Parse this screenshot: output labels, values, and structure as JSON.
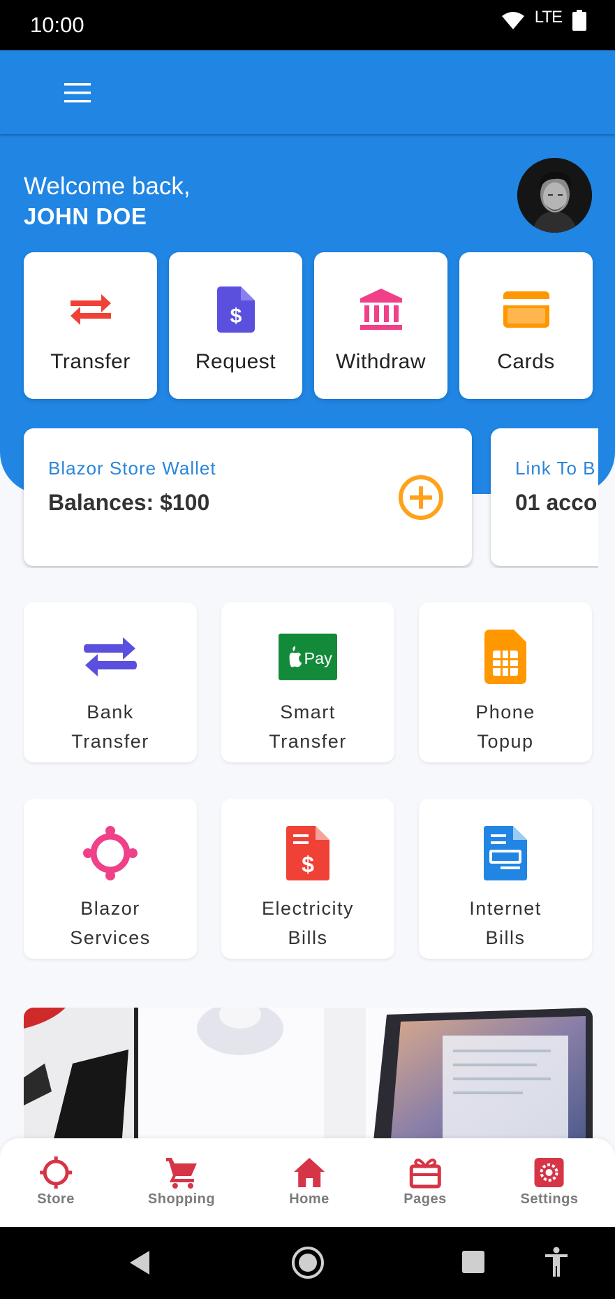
{
  "status_bar": {
    "time": "10:00",
    "network": "LTE"
  },
  "app_bar": {
    "menu_icon": "hamburger-menu-icon"
  },
  "header": {
    "greeting": "Welcome back,",
    "user_name": "JOHN DOE"
  },
  "quick_actions": [
    {
      "label": "Transfer",
      "icon": "swap-arrows-icon",
      "color": "#ef4136"
    },
    {
      "label": "Request",
      "icon": "invoice-dollar-icon",
      "color": "#5b4fde"
    },
    {
      "label": "Withdraw",
      "icon": "bank-icon",
      "color": "#f0408a"
    },
    {
      "label": "Cards",
      "icon": "credit-card-icon",
      "color": "#ff9800"
    }
  ],
  "wallets": [
    {
      "title": "Blazor Store Wallet",
      "value": "Balances: $100",
      "action_icon": "add-circle-icon"
    },
    {
      "title": "Link To B",
      "value": "01 acco"
    }
  ],
  "services": [
    {
      "label_line1": "Bank",
      "label_line2": "Transfer",
      "icon": "swap-arrows-icon",
      "color": "#5b4fde"
    },
    {
      "label_line1": "Smart",
      "label_line2": "Transfer",
      "icon": "apple-pay-icon",
      "color": "#138a3a"
    },
    {
      "label_line1": "Phone",
      "label_line2": "Topup",
      "icon": "sim-card-icon",
      "color": "#ff9800"
    },
    {
      "label_line1": "Blazor",
      "label_line2": "Services",
      "icon": "community-icon",
      "color": "#f0408a"
    },
    {
      "label_line1": "Electricity",
      "label_line2": "Bills",
      "icon": "bill-dollar-icon",
      "color": "#ef4136"
    },
    {
      "label_line1": "Internet",
      "label_line2": "Bills",
      "icon": "document-icon",
      "color": "#2085e3"
    }
  ],
  "apple_pay_text": "Pay",
  "bottom_nav": [
    {
      "label": "Store",
      "icon": "crosshair-icon"
    },
    {
      "label": "Shopping",
      "icon": "cart-icon"
    },
    {
      "label": "Home",
      "icon": "home-icon"
    },
    {
      "label": "Pages",
      "icon": "gift-icon"
    },
    {
      "label": "Settings",
      "icon": "gear-icon"
    }
  ],
  "colors": {
    "primary": "#2085e3",
    "nav_icon": "#d63447",
    "nav_label": "#7b7b7b",
    "wallet_title": "#2b86d9",
    "add_button": "#ffa21a"
  }
}
